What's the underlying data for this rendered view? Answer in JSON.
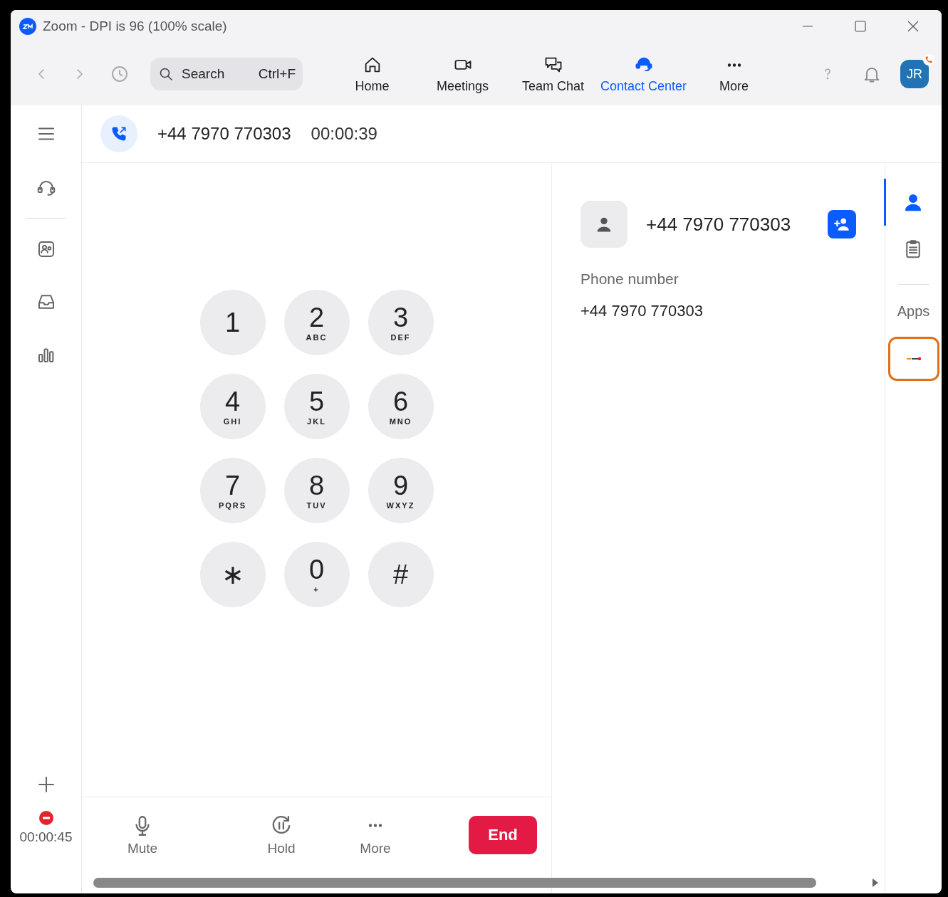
{
  "window": {
    "title": "Zoom - DPI is 96 (100% scale)"
  },
  "toolbar": {
    "search": {
      "placeholder": "Search",
      "shortcut": "Ctrl+F"
    },
    "tabs": [
      {
        "label": "Home",
        "selected": false
      },
      {
        "label": "Meetings",
        "selected": false
      },
      {
        "label": "Team Chat",
        "selected": false
      },
      {
        "label": "Contact Center",
        "selected": true
      },
      {
        "label": "More",
        "selected": false
      }
    ],
    "avatar": {
      "initials": "JR"
    }
  },
  "left_rail": {
    "items": [
      {
        "selected": false
      },
      {
        "selected": false
      },
      {
        "selected": false
      },
      {
        "selected": false
      }
    ],
    "timer": "00:00:45"
  },
  "call": {
    "number": "+44 7970 770303",
    "duration": "00:00:39"
  },
  "keypad": [
    {
      "digit": "1"
    },
    {
      "digit": "2",
      "letters": "ABC"
    },
    {
      "digit": "3",
      "letters": "DEF"
    },
    {
      "digit": "4",
      "letters": "GHI"
    },
    {
      "digit": "5",
      "letters": "JKL"
    },
    {
      "digit": "6",
      "letters": "MNO"
    },
    {
      "digit": "7",
      "letters": "PQRS"
    },
    {
      "digit": "8",
      "letters": "TUV"
    },
    {
      "digit": "9",
      "letters": "WXYZ"
    },
    {
      "digit": "∗"
    },
    {
      "digit": "0",
      "letters": "+"
    },
    {
      "digit": "#"
    }
  ],
  "controls": [
    {
      "label": "Mute",
      "kind": "mic"
    },
    {
      "label": "Hold",
      "kind": "hold"
    },
    {
      "label": "More",
      "kind": "dots"
    }
  ],
  "end_button": "End",
  "contact": {
    "name": "+44 7970 770303",
    "field_label": "Phone number",
    "field_value": "+44 7970 770303"
  },
  "right_rail": {
    "items": [
      {
        "selected": true
      },
      {
        "selected": false
      }
    ],
    "apps_label": "Apps",
    "app": {
      "highlighted": true
    }
  }
}
